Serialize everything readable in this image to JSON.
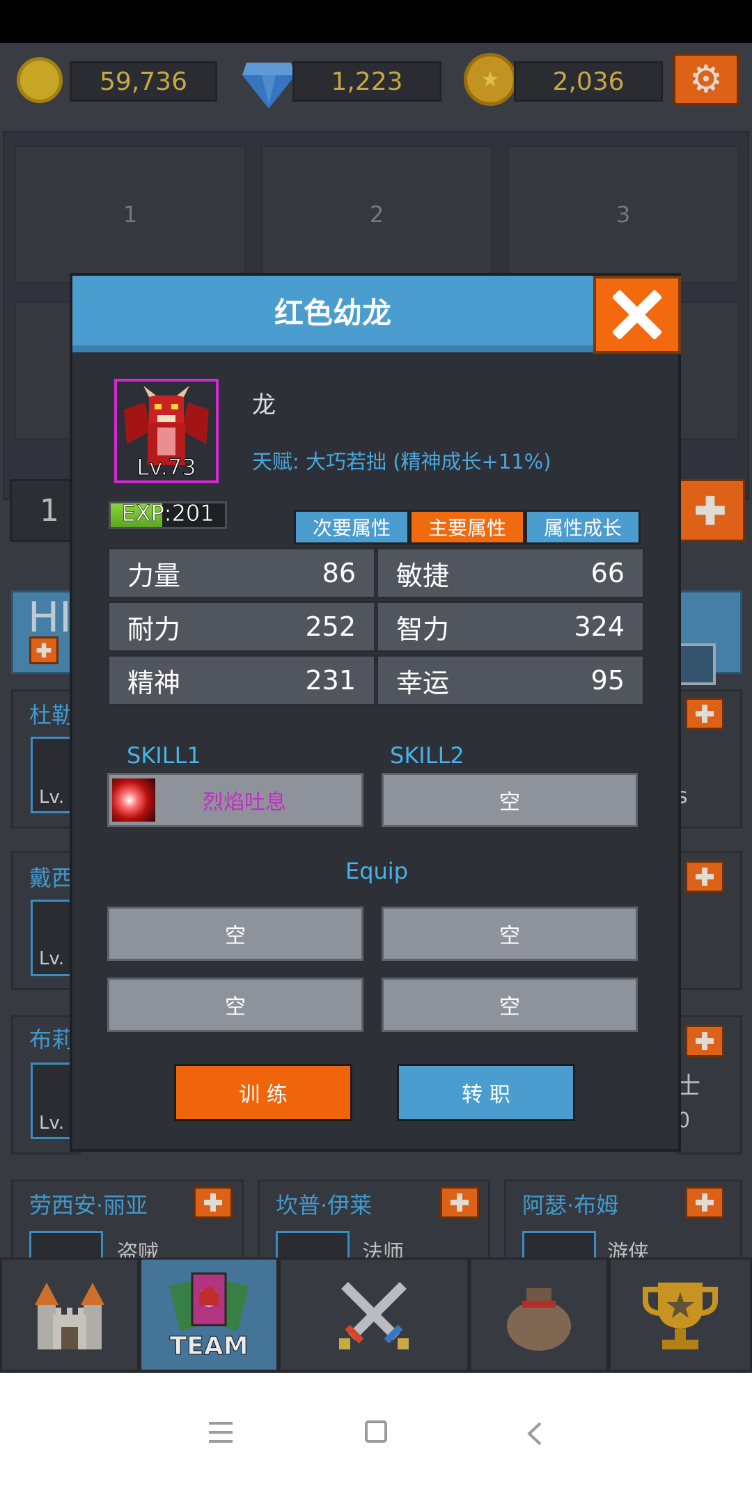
{
  "currency": {
    "gold": "59,736",
    "gems": "1,223",
    "medals": "2,036"
  },
  "slots": [
    "1",
    "2",
    "3"
  ],
  "background": {
    "left_number": "1",
    "hero_label": "HI",
    "cards": [
      {
        "name": "杜勒",
        "lv": "Lv."
      },
      {
        "name": "戴西",
        "lv": "Lv."
      },
      {
        "name": "布莉",
        "lv": "Lv."
      }
    ],
    "right_cards": [
      {
        "sub": "s"
      },
      {
        "sub": ""
      },
      {
        "sub": "士",
        "sub2": "0"
      }
    ],
    "bottom_cards": [
      {
        "name": "劳西安·丽亚",
        "sub": "盗贼"
      },
      {
        "name": "坎普·伊莱",
        "sub": "法师"
      },
      {
        "name": "阿瑟·布姆",
        "sub": "游侠"
      }
    ]
  },
  "modal": {
    "title": "红色幼龙",
    "portrait_level": "Lv.73",
    "race": "龙",
    "talent": "天赋: 大巧若拙 (精神成长+11%)",
    "exp_label": "EXP:201",
    "exp_fraction": 0.45,
    "tabs": [
      "次要属性",
      "主要属性",
      "属性成长"
    ],
    "active_tab": 1,
    "stats": [
      {
        "name": "力量",
        "value": "86"
      },
      {
        "name": "敏捷",
        "value": "66"
      },
      {
        "name": "耐力",
        "value": "252"
      },
      {
        "name": "智力",
        "value": "324"
      },
      {
        "name": "精神",
        "value": "231"
      },
      {
        "name": "幸运",
        "value": "95"
      }
    ],
    "skill1_label": "SKILL1",
    "skill2_label": "SKILL2",
    "skill1_name": "烈焰吐息",
    "skill2_name": "空",
    "equip_label": "Equip",
    "equip": [
      "空",
      "空",
      "空",
      "空"
    ],
    "train_label": "训 练",
    "job_change_label": "转 职"
  },
  "nav": {
    "team_label": "TEAM",
    "active": "team"
  },
  "colors": {
    "accent_orange": "#f06a10",
    "accent_blue": "#4b9ccf",
    "skill_name": "#c02fc0",
    "talent_text": "#47a8e0"
  }
}
